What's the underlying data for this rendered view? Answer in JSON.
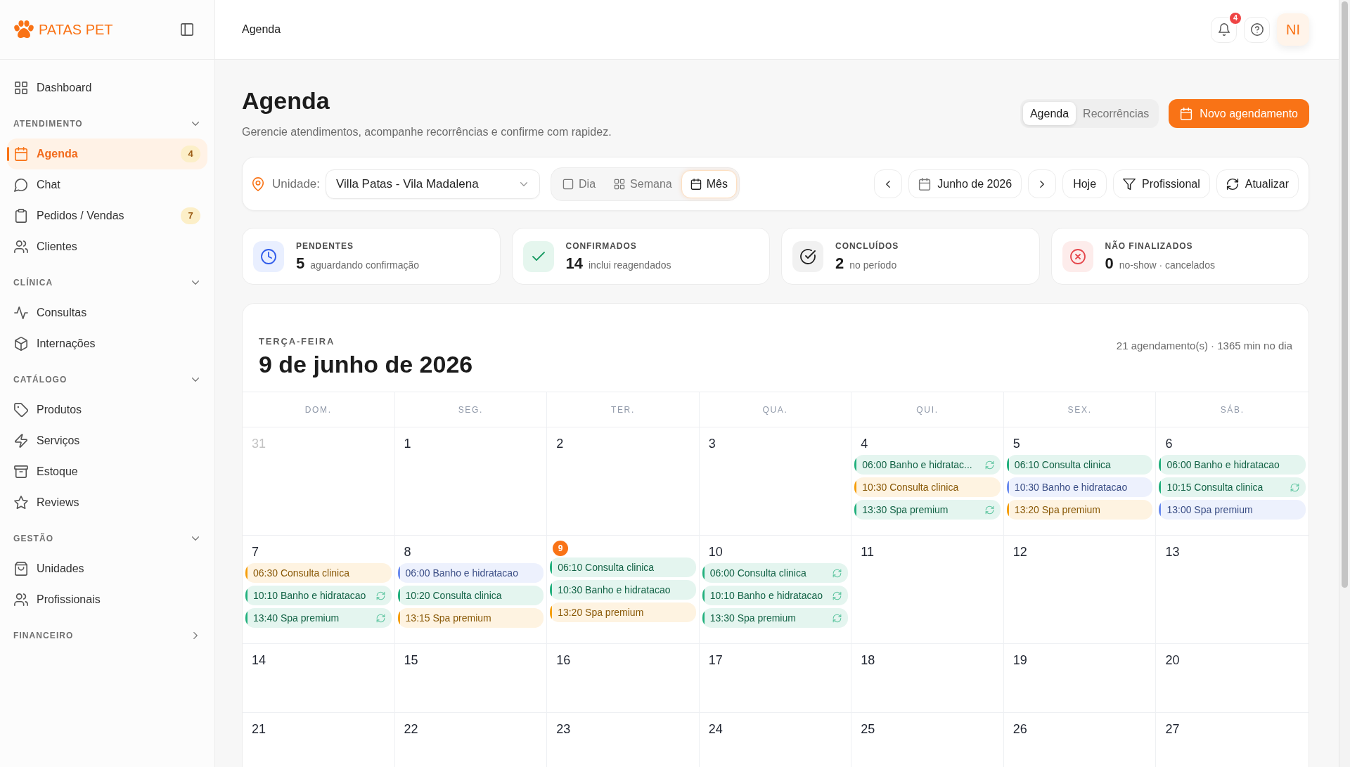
{
  "sidebar": {
    "brand": "PATAS PET",
    "top_items": [
      {
        "label": "Dashboard",
        "selected": false
      }
    ],
    "sections": [
      {
        "title": "ATENDIMENTO",
        "expanded": true,
        "items": [
          {
            "label": "Agenda",
            "selected": true,
            "badge": "4"
          },
          {
            "label": "Chat",
            "selected": false
          },
          {
            "label": "Pedidos / Vendas",
            "selected": false,
            "badge": "7"
          },
          {
            "label": "Clientes",
            "selected": false
          }
        ]
      },
      {
        "title": "CLÍNICA",
        "expanded": true,
        "items": [
          {
            "label": "Consultas",
            "selected": false
          },
          {
            "label": "Internações",
            "selected": false
          }
        ]
      },
      {
        "title": "CATÁLOGO",
        "expanded": true,
        "items": [
          {
            "label": "Produtos",
            "selected": false
          },
          {
            "label": "Serviços",
            "selected": false
          },
          {
            "label": "Estoque",
            "selected": false
          },
          {
            "label": "Reviews",
            "selected": false
          }
        ]
      },
      {
        "title": "GESTÃO",
        "expanded": true,
        "items": [
          {
            "label": "Unidades",
            "selected": false
          },
          {
            "label": "Profissionais",
            "selected": false
          }
        ]
      },
      {
        "title": "FINANCEIRO",
        "expanded": false
      }
    ]
  },
  "header": {
    "title": "Agenda",
    "notification_count": "4",
    "avatar_initials": "NI"
  },
  "page": {
    "title": "Agenda",
    "subtitle": "Gerencie atendimentos, acompanhe recorrências e confirme com rapidez.",
    "tabs": [
      {
        "label": "Agenda",
        "selected": true
      },
      {
        "label": "Recorrências",
        "selected": false
      }
    ],
    "primary_button": "Novo agendamento"
  },
  "toolbar": {
    "unit_label": "Unidade:",
    "unit_value": "Villa Patas - Vila Madalena",
    "views": [
      {
        "label": "Dia",
        "selected": false
      },
      {
        "label": "Semana",
        "selected": false
      },
      {
        "label": "Mês",
        "selected": true
      }
    ],
    "period": "Junho de 2026",
    "today_button": "Hoje",
    "filter_button": "Profissional",
    "refresh_button": "Atualizar"
  },
  "stats": [
    {
      "kind": "pending",
      "label": "PENDENTES",
      "value": "5",
      "caption": "aguardando confirmação"
    },
    {
      "kind": "confirmed",
      "label": "CONFIRMADOS",
      "value": "14",
      "caption": "inclui reagendados"
    },
    {
      "kind": "completed",
      "label": "CONCLUÍDOS",
      "value": "2",
      "caption": "no período"
    },
    {
      "kind": "unfinished",
      "label": "NÃO FINALIZADOS",
      "value": "0",
      "caption": "no-show · cancelados"
    }
  ],
  "calendar": {
    "weekday": "TERÇA-FEIRA",
    "date": "9 de junho de 2026",
    "summary": "21 agendamento(s) · 1365 min no dia",
    "weekdays": [
      "DOM.",
      "SEG.",
      "TER.",
      "QUA.",
      "QUI.",
      "SEX.",
      "SÁB."
    ],
    "weeks": [
      {
        "days": [
          {
            "day": "31",
            "outside": true,
            "today": false
          },
          {
            "day": "1",
            "outside": false,
            "today": false
          },
          {
            "day": "2",
            "outside": false,
            "today": false
          },
          {
            "day": "3",
            "outside": false,
            "today": false
          },
          {
            "day": "4",
            "outside": false,
            "today": false,
            "events": [
              {
                "text": "06:00 Banho e hidratac...",
                "color": "#22b07d",
                "recurring": true
              },
              {
                "text": "10:30 Consulta clinica",
                "color": "#f59e0b",
                "recurring": false
              },
              {
                "text": "13:30 Spa premium",
                "color": "#22b07d",
                "recurring": true
              }
            ]
          },
          {
            "day": "5",
            "outside": false,
            "today": false,
            "events": [
              {
                "text": "06:10 Consulta clinica",
                "color": "#22b07d",
                "recurring": false
              },
              {
                "text": "10:30 Banho e hidratacao",
                "color": "#6a8bef",
                "recurring": false
              },
              {
                "text": "13:20 Spa premium",
                "color": "#f59e0b",
                "recurring": false
              }
            ]
          },
          {
            "day": "6",
            "outside": false,
            "today": false,
            "events": [
              {
                "text": "06:00 Banho e hidratacao",
                "color": "#22b07d",
                "recurring": false
              },
              {
                "text": "10:15 Consulta clinica",
                "color": "#22b07d",
                "recurring": true
              },
              {
                "text": "13:00 Spa premium",
                "color": "#6a8bef",
                "recurring": false
              }
            ]
          }
        ]
      },
      {
        "days": [
          {
            "day": "7",
            "outside": false,
            "today": false,
            "events": [
              {
                "text": "06:30 Consulta clinica",
                "color": "#f59e0b",
                "recurring": false
              },
              {
                "text": "10:10 Banho e hidratacao",
                "color": "#22b07d",
                "recurring": true
              },
              {
                "text": "13:40 Spa premium",
                "color": "#22b07d",
                "recurring": true
              }
            ]
          },
          {
            "day": "8",
            "outside": false,
            "today": false,
            "events": [
              {
                "text": "06:00 Banho e hidratacao",
                "color": "#6a8bef",
                "recurring": false
              },
              {
                "text": "10:20 Consulta clinica",
                "color": "#22b07d",
                "recurring": false
              },
              {
                "text": "13:15 Spa premium",
                "color": "#f59e0b",
                "recurring": false
              }
            ]
          },
          {
            "day": "9",
            "outside": false,
            "today": true,
            "events": [
              {
                "text": "06:10 Consulta clinica",
                "color": "#22b07d",
                "recurring": false
              },
              {
                "text": "10:30 Banho e hidratacao",
                "color": "#22b07d",
                "recurring": false
              },
              {
                "text": "13:20 Spa premium",
                "color": "#f59e0b",
                "recurring": false
              }
            ]
          },
          {
            "day": "10",
            "outside": false,
            "today": false,
            "events": [
              {
                "text": "06:00 Consulta clinica",
                "color": "#22b07d",
                "recurring": true
              },
              {
                "text": "10:10 Banho e hidratacao",
                "color": "#22b07d",
                "recurring": true
              },
              {
                "text": "13:30 Spa premium",
                "color": "#22b07d",
                "recurring": true
              }
            ]
          },
          {
            "day": "11",
            "outside": false,
            "today": false
          },
          {
            "day": "12",
            "outside": false,
            "today": false
          },
          {
            "day": "13",
            "outside": false,
            "today": false
          }
        ]
      },
      {
        "days": [
          {
            "day": "14",
            "outside": false,
            "today": false
          },
          {
            "day": "15",
            "outside": false,
            "today": false
          },
          {
            "day": "16",
            "outside": false,
            "today": false
          },
          {
            "day": "17",
            "outside": false,
            "today": false
          },
          {
            "day": "18",
            "outside": false,
            "today": false
          },
          {
            "day": "19",
            "outside": false,
            "today": false
          },
          {
            "day": "20",
            "outside": false,
            "today": false
          }
        ]
      },
      {
        "days": [
          {
            "day": "21",
            "outside": false,
            "today": false
          },
          {
            "day": "22",
            "outside": false,
            "today": false
          },
          {
            "day": "23",
            "outside": false,
            "today": false
          },
          {
            "day": "24",
            "outside": false,
            "today": false
          },
          {
            "day": "25",
            "outside": false,
            "today": false
          },
          {
            "day": "26",
            "outside": false,
            "today": false
          },
          {
            "day": "27",
            "outside": false,
            "today": false
          }
        ]
      }
    ]
  }
}
